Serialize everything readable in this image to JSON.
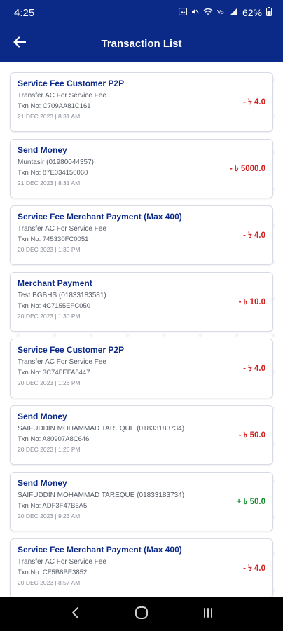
{
  "status_bar": {
    "time": "4:25",
    "battery": "62%",
    "icons": [
      "gallery-icon",
      "mute-icon",
      "wifi-icon",
      "volte-icon",
      "signal-icon",
      "battery-icon"
    ]
  },
  "header": {
    "title": "Transaction List",
    "back_icon": "arrow-left-icon"
  },
  "colors": {
    "primary": "#0b2a87",
    "debit": "#d0201f",
    "credit": "#148a2f"
  },
  "transactions": [
    {
      "title": "Service Fee Customer P2P",
      "description": "Transfer AC For Service Fee",
      "txn": "Txn No: C709AA81C161",
      "date": "21 DEC 2023 | 8:31 AM",
      "amount": "- ৳ 4.0",
      "type": "debit"
    },
    {
      "title": "Send Money",
      "description": "Muntasir (01980044357)",
      "txn": "Txn No: 87E034150060",
      "date": "21 DEC 2023 | 8:31 AM",
      "amount": "- ৳ 5000.0",
      "type": "debit"
    },
    {
      "title": "Service Fee Merchant Payment (Max 400)",
      "description": "Transfer AC For Service Fee",
      "txn": "Txn No: 745330FC0051",
      "date": "20 DEC 2023 | 1:30 PM",
      "amount": "- ৳ 4.0",
      "type": "debit"
    },
    {
      "title": "Merchant Payment",
      "description": "Test BGBHS (01833183581)",
      "txn": "Txn No: 4C7155EFC050",
      "date": "20 DEC 2023 | 1:30 PM",
      "amount": "- ৳ 10.0",
      "type": "debit"
    },
    {
      "title": "Service Fee Customer P2P",
      "description": "Transfer AC For Service Fee",
      "txn": "Txn No: 3C74FEFA8447",
      "date": "20 DEC 2023 | 1:26 PM",
      "amount": "- ৳ 4.0",
      "type": "debit"
    },
    {
      "title": "Send Money",
      "description": "SAIFUDDIN MOHAMMAD TAREQUE (01833183734)",
      "txn": "Txn No: A80907A8C646",
      "date": "20 DEC 2023 | 1:26 PM",
      "amount": "- ৳ 50.0",
      "type": "debit"
    },
    {
      "title": "Send Money",
      "description": "SAIFUDDIN MOHAMMAD TAREQUE (01833183734)",
      "txn": "Txn No: ADF3F47B6A5",
      "date": "20 DEC 2023 | 9:23 AM",
      "amount": "+ ৳ 50.0",
      "type": "credit"
    },
    {
      "title": "Service Fee Merchant Payment (Max 400)",
      "description": "Transfer AC For Service Fee",
      "txn": "Txn No: CF5B8BE3852",
      "date": "20 DEC 2023 | 8:57 AM",
      "amount": "- ৳ 4.0",
      "type": "debit"
    }
  ],
  "nav_bar": {
    "icons": [
      "nav-back-icon",
      "nav-home-icon",
      "nav-recents-icon"
    ]
  }
}
